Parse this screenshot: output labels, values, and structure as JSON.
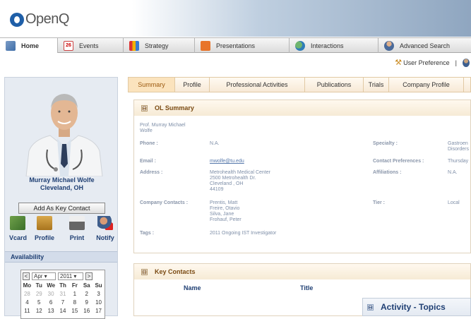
{
  "app": {
    "logo_text": "OpenQ"
  },
  "nav": {
    "tabs": [
      {
        "label": "Home"
      },
      {
        "label": "Events",
        "badge": "26"
      },
      {
        "label": "Strategy"
      },
      {
        "label": "Presentations"
      },
      {
        "label": "Interactions"
      },
      {
        "label": "Advanced Search"
      }
    ]
  },
  "toolbar": {
    "user_preference": "User Preference",
    "separator": "|"
  },
  "profile": {
    "name_line1": "Murray Michael Wolfe",
    "name_line2": "Cleveland, OH",
    "add_key_contact": "Add As Key Contact",
    "actions": [
      {
        "label": "Vcard"
      },
      {
        "label": "Profile"
      },
      {
        "label": "Print"
      },
      {
        "label": "Notify"
      }
    ],
    "availability": "Availability"
  },
  "calendar": {
    "prev": "<",
    "next": ">",
    "month": "Apr",
    "year": "2011",
    "days": [
      "Mo",
      "Tu",
      "We",
      "Th",
      "Fr",
      "Sa",
      "Su"
    ],
    "weeks": [
      [
        "28",
        "29",
        "30",
        "31",
        "1",
        "2",
        "3"
      ],
      [
        "4",
        "5",
        "6",
        "7",
        "8",
        "9",
        "10"
      ],
      [
        "11",
        "12",
        "13",
        "14",
        "15",
        "16",
        "17"
      ]
    ]
  },
  "subtabs": [
    {
      "label": "Summary"
    },
    {
      "label": "Profile"
    },
    {
      "label": "Professional Activities"
    },
    {
      "label": "Publications"
    },
    {
      "label": "Trials"
    },
    {
      "label": "Company Profile"
    }
  ],
  "summary": {
    "title": "OL Summary",
    "toggle": "⊟",
    "ol_name_line1": "Prof. Murray Michael",
    "ol_name_line2": "Wolfe",
    "phone_label": "Phone :",
    "phone_value": "N.A.",
    "specialty_label": "Specialty :",
    "specialty_value_line1": "Gastroen",
    "specialty_value_line2": "Disorders",
    "email_label": "Email :",
    "email_value": "mwolfe@tu.edu",
    "contact_pref_label": "Contact Preferences :",
    "contact_pref_value": "Thursday",
    "address_label": "Address :",
    "address_lines": [
      "Metrohealth Medical Center",
      "2500 Metrohealth Dr.",
      "Cleveland , OH",
      "44109"
    ],
    "affiliations_label": "Affiliations :",
    "affiliations_value": "N.A.",
    "company_contacts_label": "Company Contacts :",
    "company_contacts": [
      "Prentis, Matt",
      "Freire, Otavio",
      "Silva, Jane",
      "Frohauf, Peter"
    ],
    "tier_label": "Tier :",
    "tier_value": "Local",
    "tags_label": "Tags :",
    "tags_value": "2011 Ongoing IST Investigator"
  },
  "key_contacts": {
    "title": "Key Contacts",
    "toggle": "⊟",
    "col_name": "Name",
    "col_title": "Title"
  },
  "activity": {
    "title": "Activity - Topics",
    "toggle": "⊟"
  }
}
